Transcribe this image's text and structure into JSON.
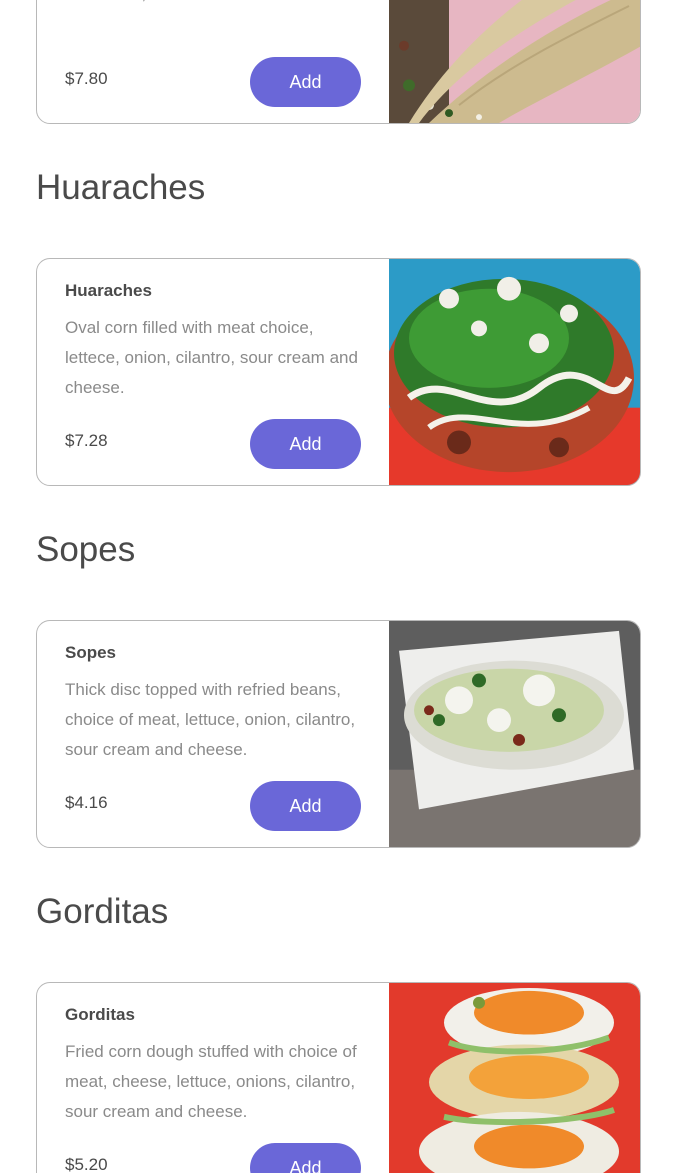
{
  "menu": {
    "partial_item": {
      "desc_tail": "with onion, cilantro and\ncilantro.",
      "price": "$7.80",
      "add_label": "Add"
    },
    "sections": [
      {
        "title": "Huaraches",
        "item": {
          "name": "Huaraches",
          "description": "Oval corn filled with meat choice, lettece, onion, cilantro, sour cream and cheese.",
          "price": "$7.28",
          "add_label": "Add"
        }
      },
      {
        "title": "Sopes",
        "item": {
          "name": "Sopes",
          "description": "Thick disc topped with refried beans, choice of meat, lettuce, onion, cilantro, sour cream and cheese.",
          "price": "$4.16",
          "add_label": "Add"
        }
      },
      {
        "title": "Gorditas",
        "item": {
          "name": "Gorditas",
          "description": "Fried corn dough stuffed with choice of meat, cheese, lettuce, onions, cilantro, sour cream and cheese.",
          "price": "$5.20",
          "add_label": "Add"
        }
      }
    ]
  },
  "colors": {
    "accent": "#6a67d8",
    "text": "#4a4a4a",
    "muted": "#8a8a8a",
    "border": "#b8b8b8"
  }
}
